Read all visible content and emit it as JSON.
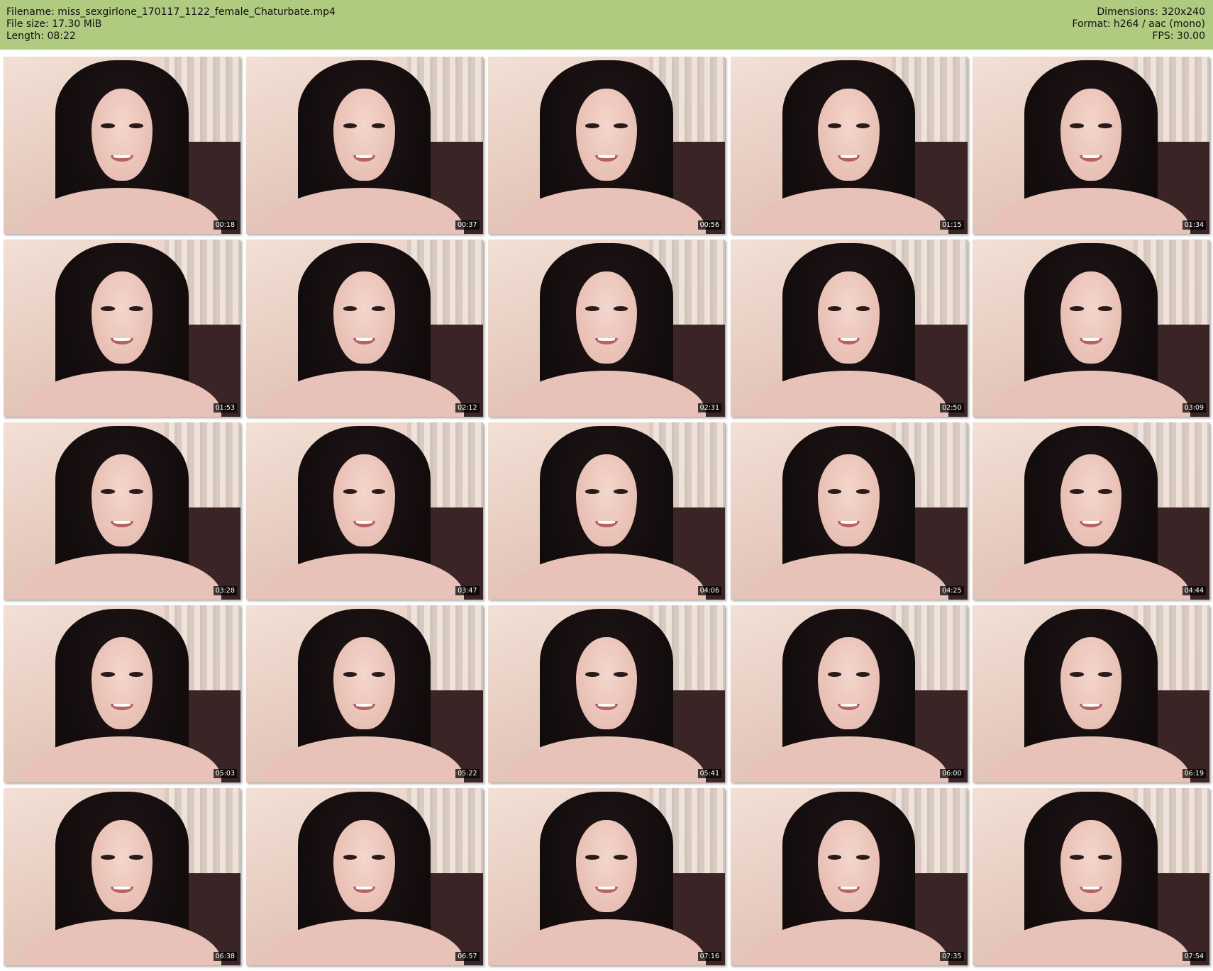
{
  "header": {
    "filename": "Filename: miss_sexgirlone_170117_1122_female_Chaturbate.mp4",
    "filesize": "File size: 17.30 MiB",
    "length": "Length: 08:22",
    "dimensions": "Dimensions: 320x240",
    "format": "Format: h264 / aac (mono)",
    "fps": "FPS: 30.00"
  },
  "colors": {
    "header_background": "#afcb80",
    "timestamp_background": "#000000",
    "timestamp_text": "#ffffff"
  },
  "thumbnails": [
    {
      "timestamp": "00:18"
    },
    {
      "timestamp": "00:37"
    },
    {
      "timestamp": "00:56"
    },
    {
      "timestamp": "01:15"
    },
    {
      "timestamp": "01:34"
    },
    {
      "timestamp": "01:53"
    },
    {
      "timestamp": "02:12"
    },
    {
      "timestamp": "02:31"
    },
    {
      "timestamp": "02:50"
    },
    {
      "timestamp": "03:09"
    },
    {
      "timestamp": "03:28"
    },
    {
      "timestamp": "03:47"
    },
    {
      "timestamp": "04:06"
    },
    {
      "timestamp": "04:25"
    },
    {
      "timestamp": "04:44"
    },
    {
      "timestamp": "05:03"
    },
    {
      "timestamp": "05:22"
    },
    {
      "timestamp": "05:41"
    },
    {
      "timestamp": "06:00"
    },
    {
      "timestamp": "06:19"
    },
    {
      "timestamp": "06:38"
    },
    {
      "timestamp": "06:57"
    },
    {
      "timestamp": "07:16"
    },
    {
      "timestamp": "07:35"
    },
    {
      "timestamp": "07:54"
    }
  ]
}
